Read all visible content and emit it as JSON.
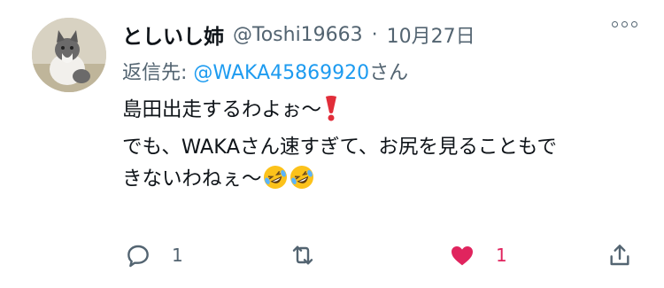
{
  "tweet": {
    "display_name": "としいし姉",
    "handle": "@Toshi19663",
    "separator": "·",
    "time": "10月27日",
    "reply_prefix": "返信先: ",
    "reply_mention": "@WAKA45869920",
    "reply_suffix": "さん",
    "line1": "島田出走するわよぉ〜",
    "line2": "でも、WAKAさん速すぎて、お尻を見ることもで",
    "line3": "きないわねぇ〜"
  },
  "actions": {
    "reply_count": "1",
    "like_count": "1"
  },
  "icons": {
    "more": "more-horizontal-icon",
    "reply": "reply-bubble-icon",
    "retweet": "retweet-icon",
    "like": "heart-filled-icon",
    "share": "share-upload-icon",
    "exclamation": "red-exclamation-emoji",
    "laugh": "rolling-laughing-emoji"
  },
  "colors": {
    "accent": "#1d9bf0",
    "like": "#e0245e",
    "muted": "#536471",
    "text": "#0f1419"
  }
}
